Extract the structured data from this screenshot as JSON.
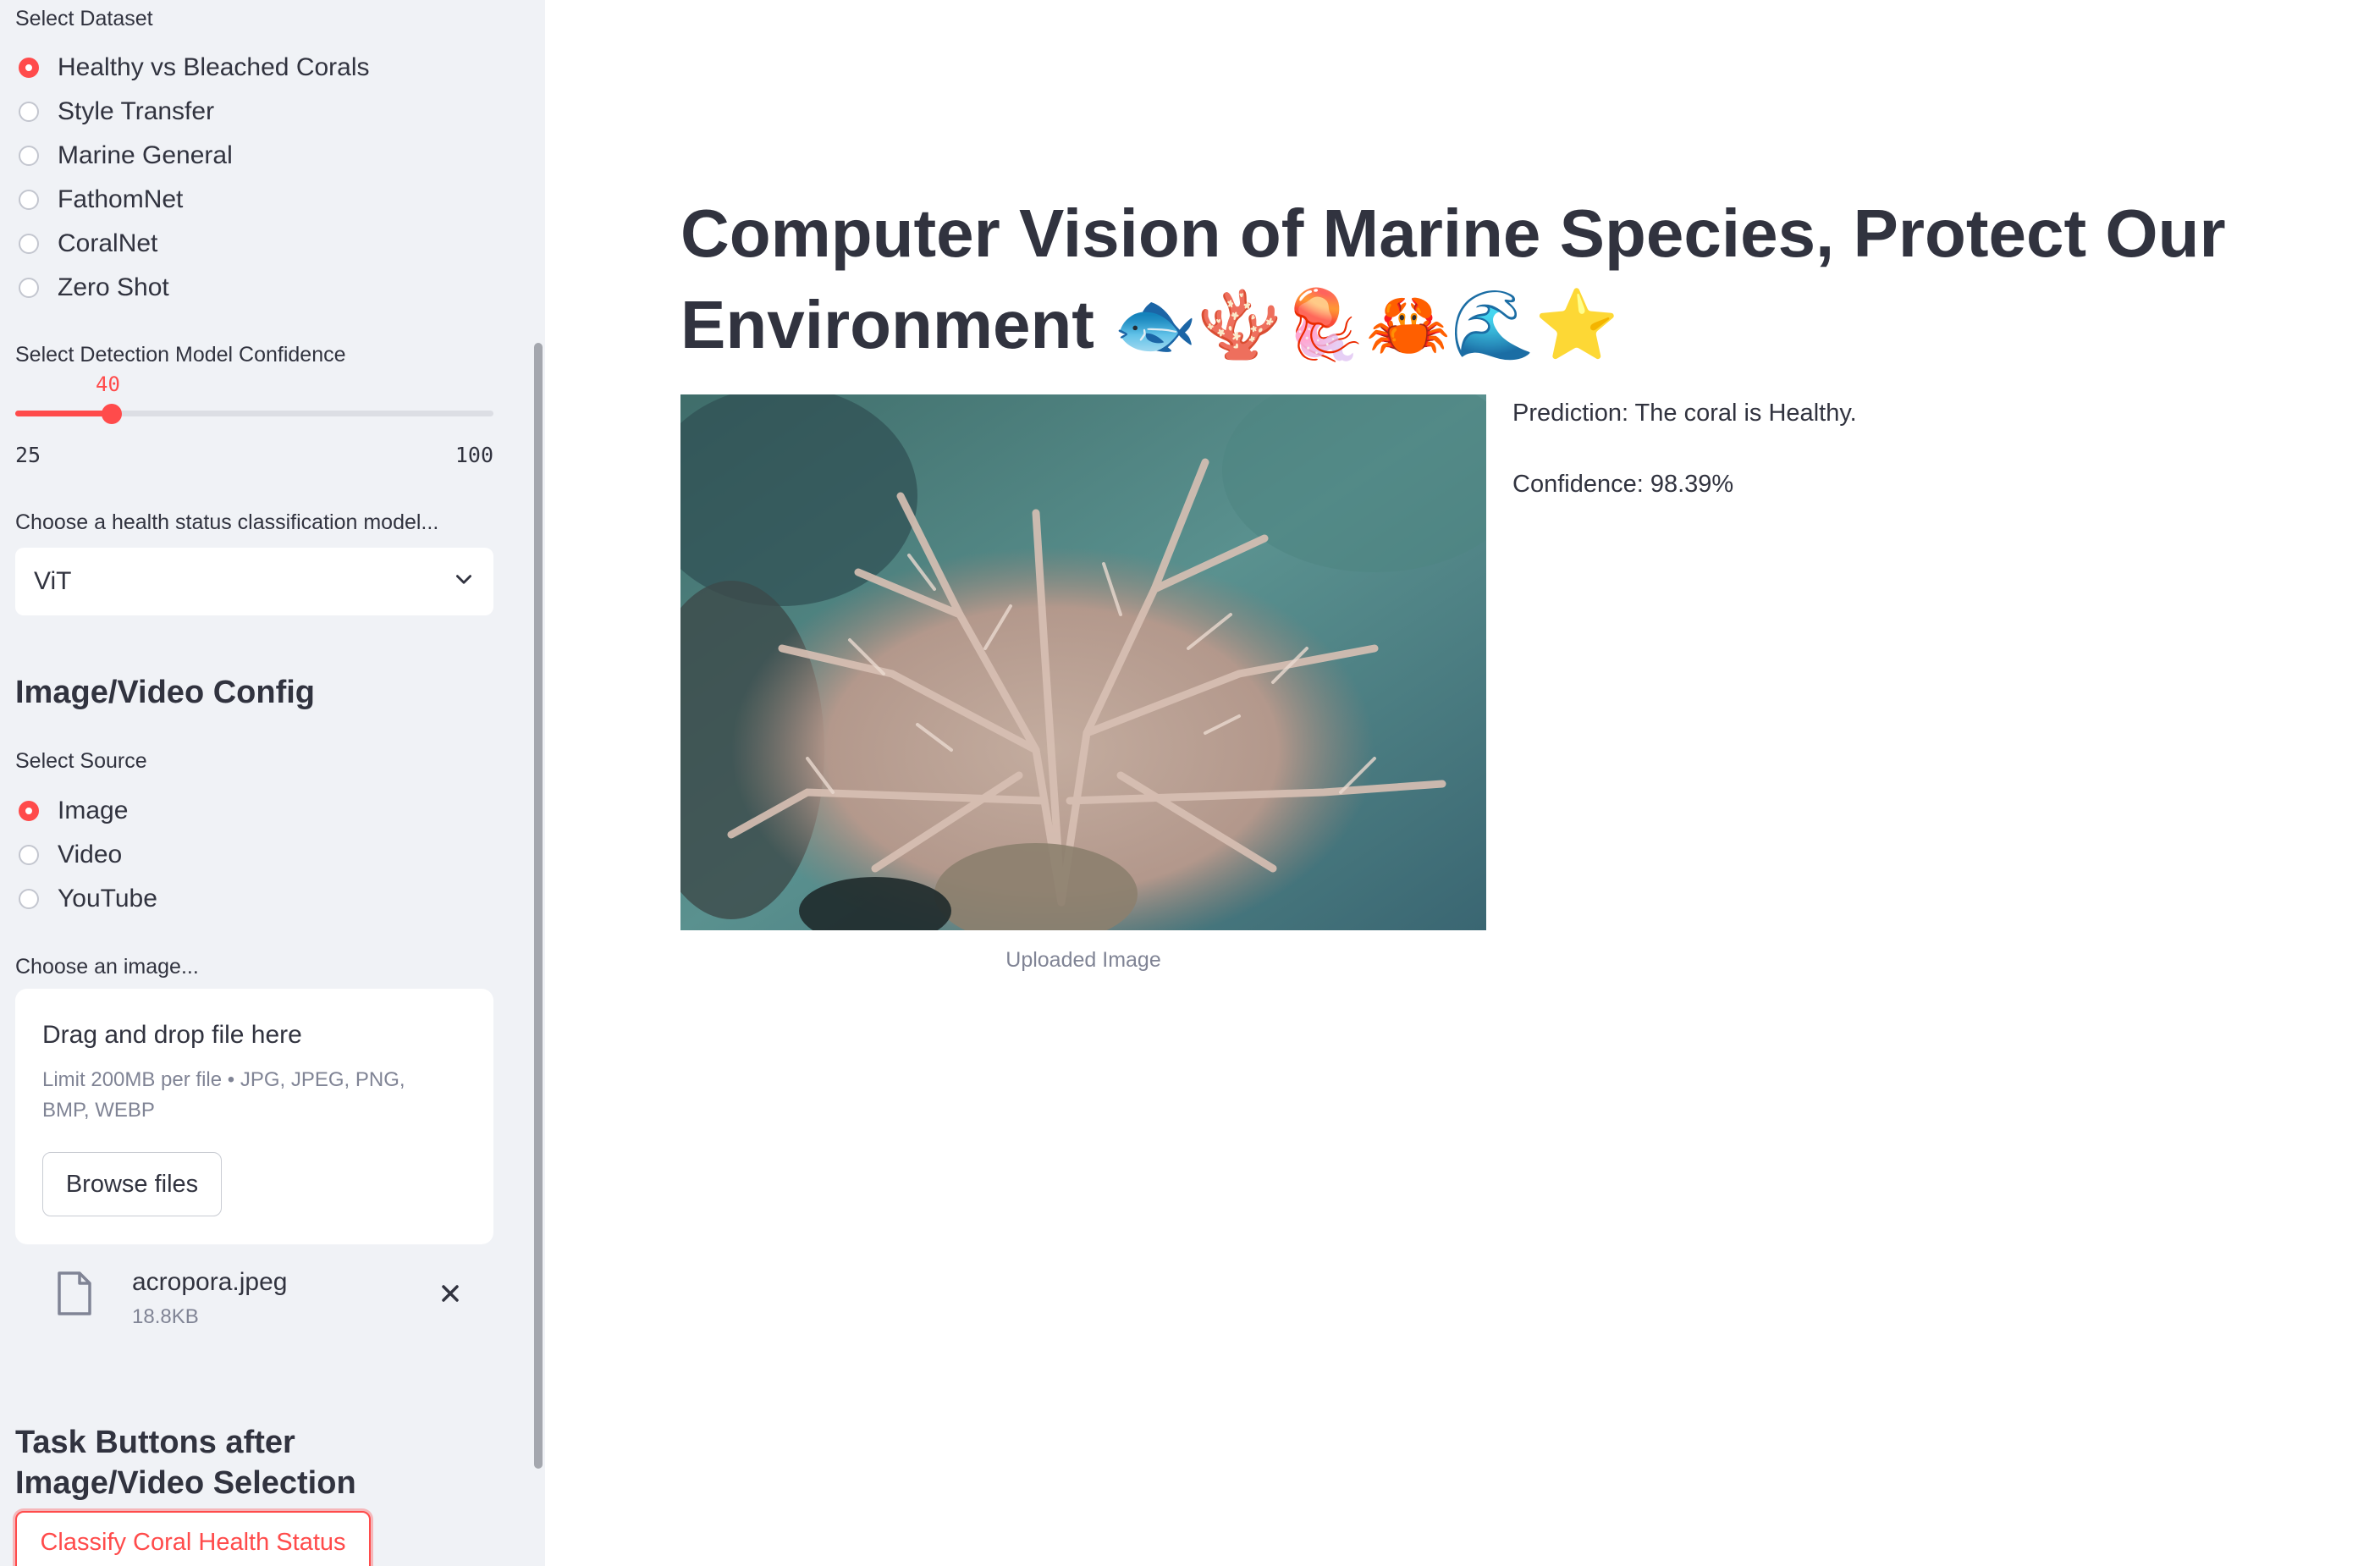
{
  "sidebar": {
    "dataset": {
      "label": "Select Dataset",
      "options": [
        "Healthy vs Bleached Corals",
        "Style Transfer",
        "Marine General",
        "FathomNet",
        "CoralNet",
        "Zero Shot"
      ],
      "selected": "Healthy vs Bleached Corals"
    },
    "confidence": {
      "label": "Select Detection Model Confidence",
      "value": "40",
      "min": "25",
      "max": "100"
    },
    "classifier": {
      "label": "Choose a health status classification model...",
      "value": "ViT"
    },
    "config_heading": "Image/Video Config",
    "source": {
      "label": "Select Source",
      "options": [
        "Image",
        "Video",
        "YouTube"
      ],
      "selected": "Image"
    },
    "uploader": {
      "label": "Choose an image...",
      "drop_text": "Drag and drop file here",
      "limit_text": "Limit 200MB per file • JPG, JPEG, PNG, BMP, WEBP",
      "browse_label": "Browse files",
      "file_name": "acropora.jpeg",
      "file_size": "18.8KB"
    },
    "tasks_heading": "Task Buttons after Image/Video Selection",
    "classify_label": "Classify Coral Health Status"
  },
  "main": {
    "title": "Computer Vision of Marine Species, Protect Our Environment 🐟🪸🪼🦀🌊⭐",
    "image_caption": "Uploaded Image",
    "prediction": "Prediction: The coral is Healthy.",
    "confidence": "Confidence: 98.39%"
  },
  "colors": {
    "accent": "#ff4b4b",
    "sidebar_bg": "#f0f2f6",
    "text": "#31333f",
    "muted": "#808495"
  },
  "icons": [
    "chevron-down-icon",
    "file-icon",
    "close-icon"
  ]
}
